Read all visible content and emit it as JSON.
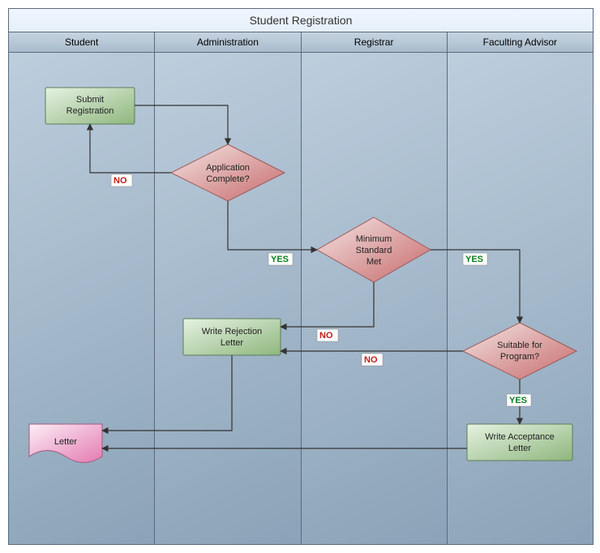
{
  "title": "Student Registration",
  "lanes": [
    "Student",
    "Administration",
    "Registrar",
    "Faculting Advisor"
  ],
  "nodes": {
    "submit": {
      "label1": "Submit",
      "label2": "Registration"
    },
    "appcomp": {
      "label1": "Application",
      "label2": "Complete?"
    },
    "minstd": {
      "label1": "Minimum",
      "label2": "Standard",
      "label3": "Met"
    },
    "reject": {
      "label1": "Write Rejection",
      "label2": "Letter"
    },
    "suitable": {
      "label1": "Suitable for",
      "label2": "Program?"
    },
    "accept": {
      "label1": "Write Acceptance",
      "label2": "Letter"
    },
    "letter": {
      "label1": "Letter"
    }
  },
  "labels": {
    "yes": "YES",
    "no": "NO"
  },
  "chart_data": {
    "type": "swimlane-flowchart",
    "title": "Student Registration",
    "lanes": [
      "Student",
      "Administration",
      "Registrar",
      "Faculting Advisor"
    ],
    "nodes": [
      {
        "id": "submit",
        "type": "process",
        "lane": "Student",
        "label": "Submit Registration"
      },
      {
        "id": "appcomp",
        "type": "decision",
        "lane": "Administration",
        "label": "Application Complete?"
      },
      {
        "id": "minstd",
        "type": "decision",
        "lane": "Registrar",
        "label": "Minimum Standard Met"
      },
      {
        "id": "reject",
        "type": "process",
        "lane": "Administration",
        "label": "Write Rejection Letter"
      },
      {
        "id": "suitable",
        "type": "decision",
        "lane": "Faculting Advisor",
        "label": "Suitable for Program?"
      },
      {
        "id": "accept",
        "type": "process",
        "lane": "Faculting Advisor",
        "label": "Write Acceptance Letter"
      },
      {
        "id": "letter",
        "type": "document",
        "lane": "Student",
        "label": "Letter"
      }
    ],
    "edges": [
      {
        "from": "submit",
        "to": "appcomp",
        "label": null
      },
      {
        "from": "appcomp",
        "to": "submit",
        "label": "NO"
      },
      {
        "from": "appcomp",
        "to": "minstd",
        "label": "YES"
      },
      {
        "from": "minstd",
        "to": "reject",
        "label": "NO"
      },
      {
        "from": "minstd",
        "to": "suitable",
        "label": "YES"
      },
      {
        "from": "suitable",
        "to": "reject",
        "label": "NO"
      },
      {
        "from": "suitable",
        "to": "accept",
        "label": "YES"
      },
      {
        "from": "reject",
        "to": "letter",
        "label": null
      },
      {
        "from": "accept",
        "to": "letter",
        "label": null
      }
    ]
  }
}
